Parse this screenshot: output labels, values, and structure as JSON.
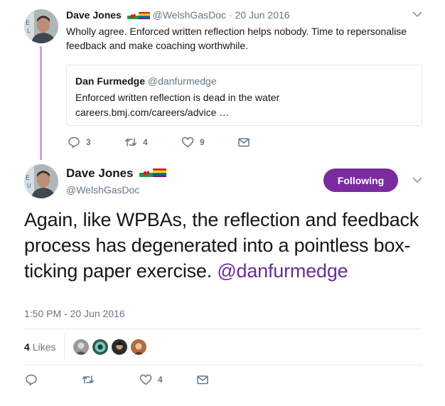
{
  "parent_tweet": {
    "author_name": "Dave Jones",
    "author_handle": "@WelshGasDoc",
    "separator": "·",
    "date": "20 Jun 2016",
    "text": "Wholly agree. Enforced written reflection helps nobody. Time to repersonalise feedback and make coaching worthwhile.",
    "quoted": {
      "author_name": "Dan Furmedge",
      "author_handle": "@danfurmedge",
      "text": "Enforced written reflection is dead in the water",
      "link": "careers.bmj.com/careers/advice …"
    },
    "actions": {
      "reply_count": "3",
      "retweet_count": "4",
      "like_count": "9"
    }
  },
  "main_tweet": {
    "author_name": "Dave Jones",
    "author_handle": "@WelshGasDoc",
    "follow_label": "Following",
    "text": "Again, like WPBAs, the reflection and feedback process has degenerated into a pointless box-ticking paper exercise.",
    "mention": "@danfurmedge",
    "timestamp": "1:50 PM - 20 Jun 2016",
    "likes_count": "4",
    "likes_label": "Likes",
    "actions": {
      "like_count": "4"
    }
  },
  "colors": {
    "accent": "#7b2aa0",
    "mention": "#6e2b95",
    "thread_line": "#c9a3d6",
    "muted_text": "#657786",
    "border": "#e1e8ed"
  },
  "icons": [
    "avatar",
    "wales-flag-icon",
    "rainbow-flag-icon",
    "chevron-down-icon",
    "reply-icon",
    "retweet-icon",
    "heart-icon",
    "envelope-icon"
  ]
}
